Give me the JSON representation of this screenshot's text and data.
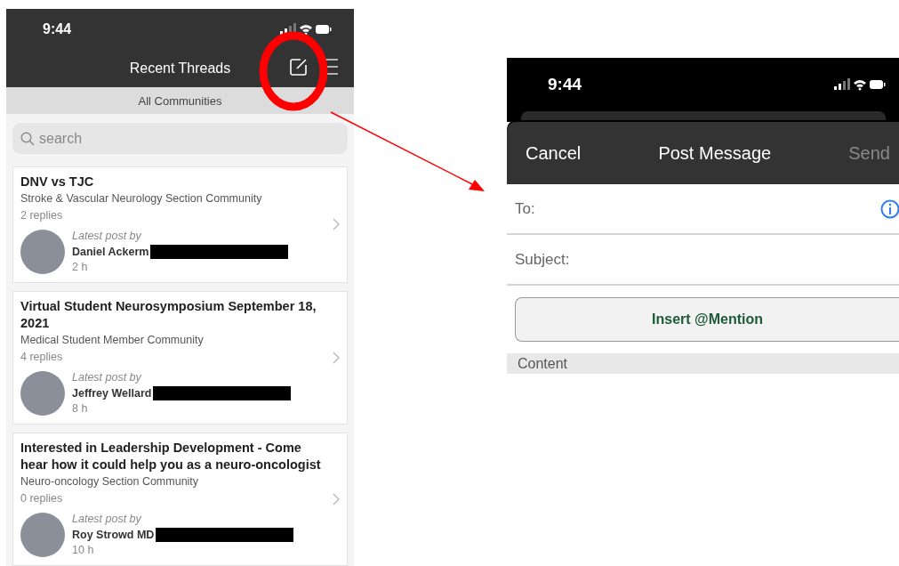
{
  "left_screen": {
    "status_time": "9:44",
    "title": "Recent Threads",
    "filter": "All Communities",
    "search": {
      "placeholder": "search"
    },
    "threads": [
      {
        "title": "DNV vs TJC",
        "community": "Stroke & Vascular Neurology Section Community",
        "replies": "2 replies",
        "latest_label": "Latest post by",
        "author": "Daniel Ackerm",
        "time": "2 h",
        "redacted": true
      },
      {
        "title": "Virtual Student Neurosymposium September 18, 2021",
        "community": "Medical Student Member Community",
        "replies": "4 replies",
        "latest_label": "Latest post by",
        "author": "Jeffrey Wellard",
        "time": "8 h",
        "redacted": true
      },
      {
        "title": "Interested in Leadership Development - Come hear how it could help you as a neuro-oncologist",
        "community": "Neuro-oncology Section Community",
        "replies": "0 replies",
        "latest_label": "Latest post by",
        "author": "Roy Strowd MD",
        "time": "10 h",
        "redacted": true
      }
    ]
  },
  "right_screen": {
    "status_time": "9:44",
    "cancel": "Cancel",
    "title": "Post Message",
    "send": {
      "label": "Send",
      "disabled": true
    },
    "fields": [
      {
        "label": "To:",
        "kind": "recipient"
      },
      {
        "label": "Subject:",
        "kind": "text"
      }
    ],
    "mention_button": "Insert @Mention",
    "section": "Content"
  }
}
